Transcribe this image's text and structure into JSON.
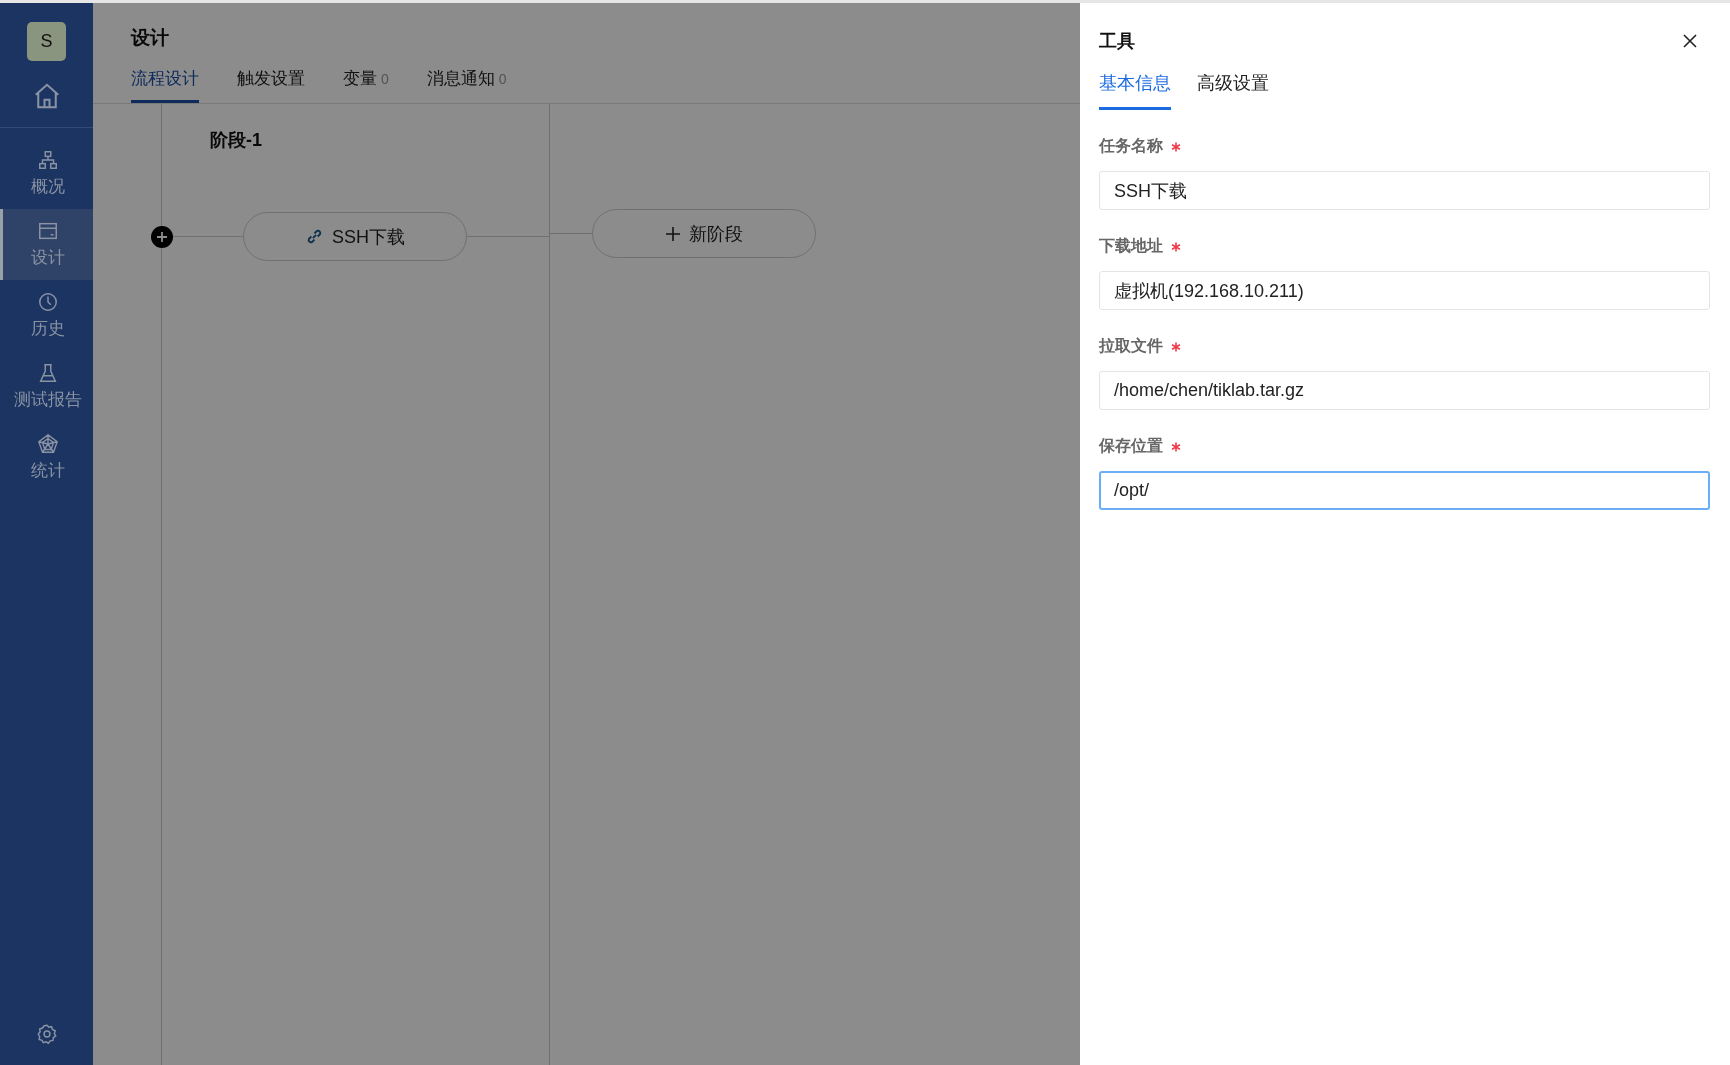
{
  "sidebar": {
    "avatar": "S",
    "items": [
      {
        "label": "概况",
        "selected": false
      },
      {
        "label": "设计",
        "selected": true
      },
      {
        "label": "历史",
        "selected": false
      },
      {
        "label": "测试报告",
        "selected": false
      },
      {
        "label": "统计",
        "selected": false
      }
    ]
  },
  "page": {
    "title": "设计",
    "tabs": [
      {
        "label": "流程设计",
        "selected": true
      },
      {
        "label": "触发设置",
        "selected": false
      },
      {
        "label": "变量",
        "count": "0",
        "selected": false
      },
      {
        "label": "消息通知",
        "count": "0",
        "selected": false
      }
    ]
  },
  "pipeline": {
    "stages": [
      {
        "title": "阶段-1",
        "jobs": [
          {
            "label": "SSH下载"
          }
        ]
      }
    ],
    "add_stage": "新阶段"
  },
  "drawer": {
    "title": "工具",
    "tabs": [
      {
        "label": "基本信息",
        "selected": true
      },
      {
        "label": "高级设置",
        "selected": false
      }
    ],
    "fields": [
      {
        "label": "任务名称",
        "required": true,
        "value": "SSH下载",
        "focused": false
      },
      {
        "label": "下载地址",
        "required": true,
        "value": "虚拟机(192.168.10.211)",
        "focused": false
      },
      {
        "label": "拉取文件",
        "required": true,
        "value": "/home/chen/tiklab.tar.gz",
        "focused": false
      },
      {
        "label": "保存位置",
        "required": true,
        "value": "/opt/",
        "focused": true
      }
    ]
  }
}
